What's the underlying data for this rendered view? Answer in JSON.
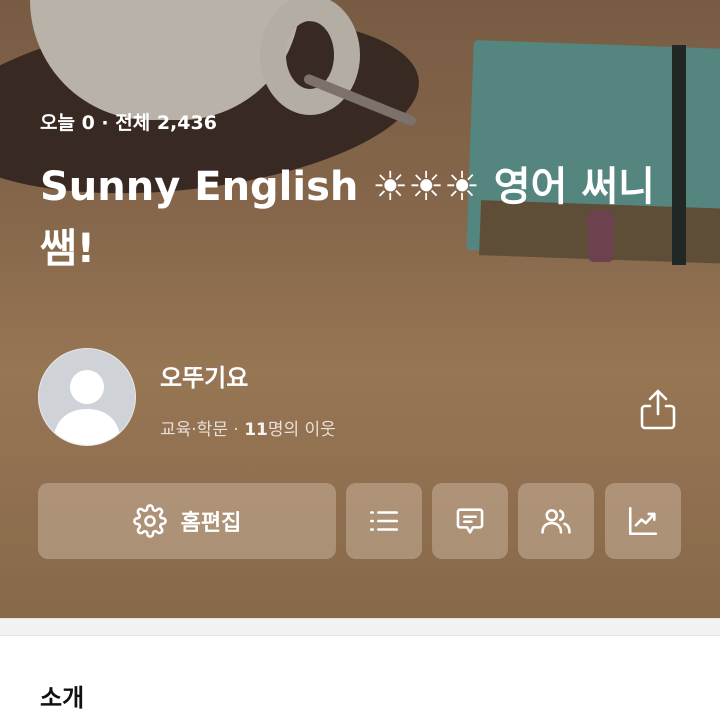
{
  "blog": {
    "visits": "오늘 0  ·  전체 2,436",
    "title": "Sunny English ☀☀☀ 영어 써니쌤!"
  },
  "profile": {
    "nickname": "오뚜기요",
    "category": "교육·학문 · ",
    "neighbors_count": "11",
    "neighbors_suffix": "명의 이웃"
  },
  "actions": {
    "edit_label": "홈편집"
  },
  "sections": {
    "intro_title": "소개"
  },
  "icons": [
    "share-icon",
    "gear-icon",
    "list-icon",
    "comment-icon",
    "neighbors-icon",
    "stats-icon"
  ]
}
